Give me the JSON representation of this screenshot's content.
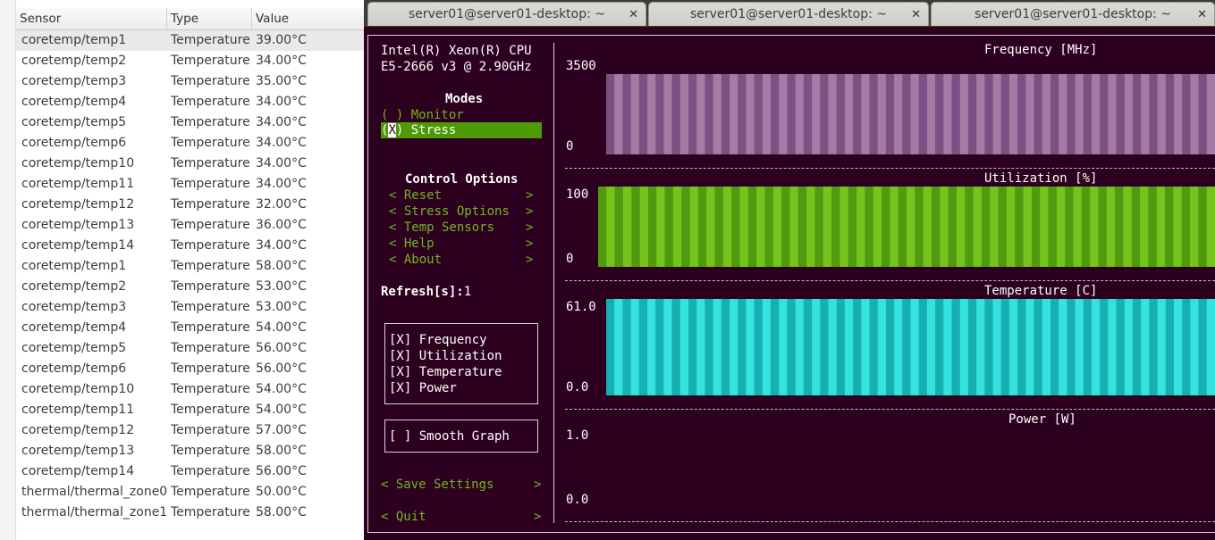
{
  "sensor_table": {
    "columns": [
      "Sensor",
      "Type",
      "Value"
    ],
    "rows": [
      {
        "sensor": "coretemp/temp1",
        "type": "Temperature",
        "value": "39.00°C"
      },
      {
        "sensor": "coretemp/temp2",
        "type": "Temperature",
        "value": "34.00°C"
      },
      {
        "sensor": "coretemp/temp3",
        "type": "Temperature",
        "value": "35.00°C"
      },
      {
        "sensor": "coretemp/temp4",
        "type": "Temperature",
        "value": "34.00°C"
      },
      {
        "sensor": "coretemp/temp5",
        "type": "Temperature",
        "value": "34.00°C"
      },
      {
        "sensor": "coretemp/temp6",
        "type": "Temperature",
        "value": "34.00°C"
      },
      {
        "sensor": "coretemp/temp10",
        "type": "Temperature",
        "value": "34.00°C"
      },
      {
        "sensor": "coretemp/temp11",
        "type": "Temperature",
        "value": "34.00°C"
      },
      {
        "sensor": "coretemp/temp12",
        "type": "Temperature",
        "value": "32.00°C"
      },
      {
        "sensor": "coretemp/temp13",
        "type": "Temperature",
        "value": "36.00°C"
      },
      {
        "sensor": "coretemp/temp14",
        "type": "Temperature",
        "value": "34.00°C"
      },
      {
        "sensor": "coretemp/temp1",
        "type": "Temperature",
        "value": "58.00°C"
      },
      {
        "sensor": "coretemp/temp2",
        "type": "Temperature",
        "value": "53.00°C"
      },
      {
        "sensor": "coretemp/temp3",
        "type": "Temperature",
        "value": "53.00°C"
      },
      {
        "sensor": "coretemp/temp4",
        "type": "Temperature",
        "value": "54.00°C"
      },
      {
        "sensor": "coretemp/temp5",
        "type": "Temperature",
        "value": "56.00°C"
      },
      {
        "sensor": "coretemp/temp6",
        "type": "Temperature",
        "value": "56.00°C"
      },
      {
        "sensor": "coretemp/temp10",
        "type": "Temperature",
        "value": "54.00°C"
      },
      {
        "sensor": "coretemp/temp11",
        "type": "Temperature",
        "value": "54.00°C"
      },
      {
        "sensor": "coretemp/temp12",
        "type": "Temperature",
        "value": "57.00°C"
      },
      {
        "sensor": "coretemp/temp13",
        "type": "Temperature",
        "value": "58.00°C"
      },
      {
        "sensor": "coretemp/temp14",
        "type": "Temperature",
        "value": "56.00°C"
      },
      {
        "sensor": "thermal/thermal_zone0",
        "type": "Temperature",
        "value": "50.00°C"
      },
      {
        "sensor": "thermal/thermal_zone1",
        "type": "Temperature",
        "value": "58.00°C"
      }
    ]
  },
  "terminal": {
    "tabs": [
      {
        "label": "server01@server01-desktop: ~",
        "close": "✕"
      },
      {
        "label": "server01@server01-desktop: ~",
        "close": "✕"
      },
      {
        "label": "server01@server01-desktop: ~",
        "close": "✕"
      }
    ],
    "cpu_line1": "Intel(R) Xeon(R) CPU",
    "cpu_line2": "E5-2666 v3 @ 2.90GHz",
    "modes_title": "Modes",
    "mode_monitor": "( ) Monitor",
    "mode_stress_mark": "X",
    "mode_stress_pre": "(",
    "mode_stress_post": ") Stress",
    "control_title": "Control Options",
    "menu": [
      {
        "left": "< Reset",
        "right": ">"
      },
      {
        "left": "< Stress Options",
        "right": ">"
      },
      {
        "left": "< Temp Sensors",
        "right": ">"
      },
      {
        "left": "< Help",
        "right": ">"
      },
      {
        "left": "< About",
        "right": ">"
      }
    ],
    "refresh_label": "Refresh[s]:",
    "refresh_value": "1",
    "checks": [
      "[X] Frequency",
      "[X] Utilization",
      "[X] Temperature",
      "[X] Power"
    ],
    "smooth": "[ ] Smooth Graph",
    "save": {
      "left": "< Save Settings",
      "right": ">"
    },
    "quit": {
      "left": "< Quit",
      "right": ">"
    }
  },
  "graphs": [
    {
      "title": "Frequency [MHz]",
      "max_label": "3500",
      "min_label": "0",
      "color_a": "#a57aa6",
      "color_b": "#7d4f84",
      "bars": 37
    },
    {
      "title": "Utilization [%]",
      "max_label": "100",
      "min_label": "0",
      "color_a": "#73c51e",
      "color_b": "#4f9a0f",
      "bars": 37
    },
    {
      "title": "Temperature [C]",
      "max_label": "61.0",
      "min_label": "0.0",
      "color_a": "#34e2e2",
      "color_b": "#16b0b0",
      "bars": 37
    },
    {
      "title": "Power [W]",
      "max_label": "1.0",
      "min_label": "0.0",
      "color_a": "",
      "color_b": "",
      "bars": 0
    }
  ]
}
